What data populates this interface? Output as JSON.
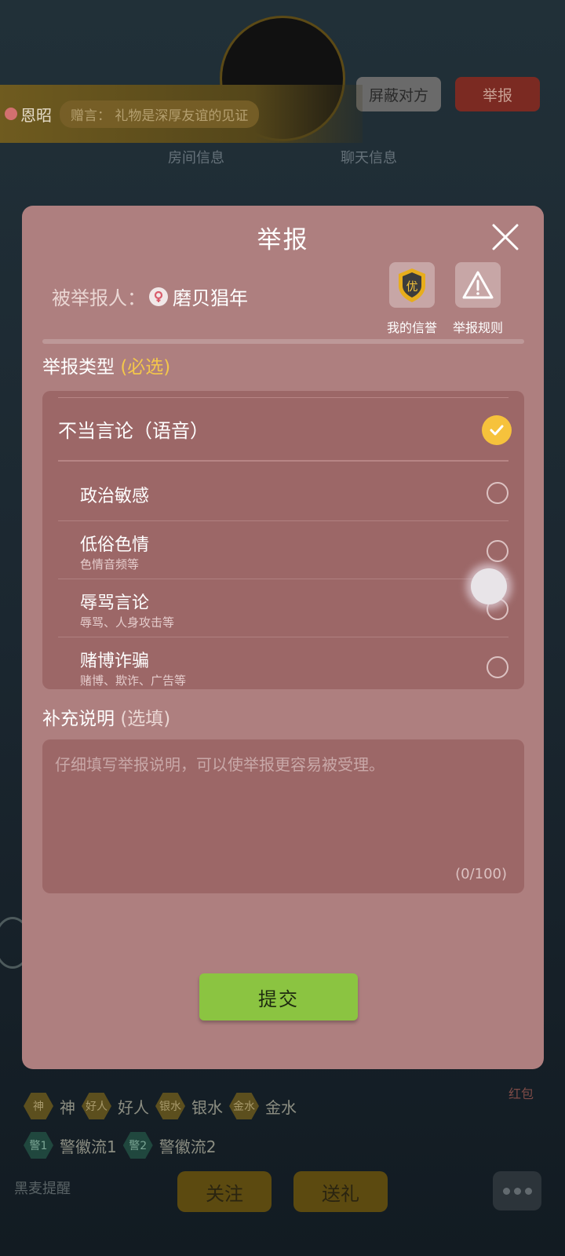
{
  "background": {
    "shield_button": "屏蔽对方",
    "report_button": "举报",
    "gift_banner": {
      "sender": "恩昭",
      "message": "赠言：  礼物是深厚友谊的见证"
    },
    "tabs": [
      "房间信息",
      "聊天信息"
    ],
    "badges_row1": [
      {
        "tag": "神",
        "text": "神"
      },
      {
        "tag": "好人",
        "text": "好人"
      },
      {
        "tag": "银水",
        "text": "银水"
      },
      {
        "tag": "金水",
        "text": "金水"
      }
    ],
    "badges_row2": [
      {
        "tag": "警1",
        "text": "警徽流1"
      },
      {
        "tag": "警2",
        "text": "警徽流2"
      }
    ],
    "follow_button": "关注",
    "gift_button": "送礼",
    "red_packet": "红包",
    "mic_reminder": "黑麦提醒"
  },
  "dialog": {
    "title": "举报",
    "reported_label": "被举报人：",
    "reported_name": "磨贝猖年",
    "credit": {
      "badge": "优",
      "caption": "我的信誉"
    },
    "rules": {
      "caption": "举报规则"
    },
    "type_section": {
      "label": "举报类型",
      "hint": "(必选)"
    },
    "category": {
      "label": "不当言论（语音）",
      "selected": true
    },
    "sub_options": [
      {
        "title": "政治敏感",
        "desc": ""
      },
      {
        "title": "低俗色情",
        "desc": "色情音频等"
      },
      {
        "title": "辱骂言论",
        "desc": "辱骂、人身攻击等"
      },
      {
        "title": "赌博诈骗",
        "desc": "赌博、欺诈、广告等"
      }
    ],
    "note_section": {
      "label": "补充说明",
      "hint": "(选填)"
    },
    "note_placeholder": "仔细填写举报说明，可以使举报更容易被受理。",
    "note_counter": "(0/100)",
    "submit_label": "提交"
  },
  "colors": {
    "dialog_bg": "#ae7f7f",
    "panel_bg": "#9c6767",
    "required_hint": "#f4c74a",
    "selected_check": "#f6c23c",
    "submit_bg": "#8bc441"
  }
}
